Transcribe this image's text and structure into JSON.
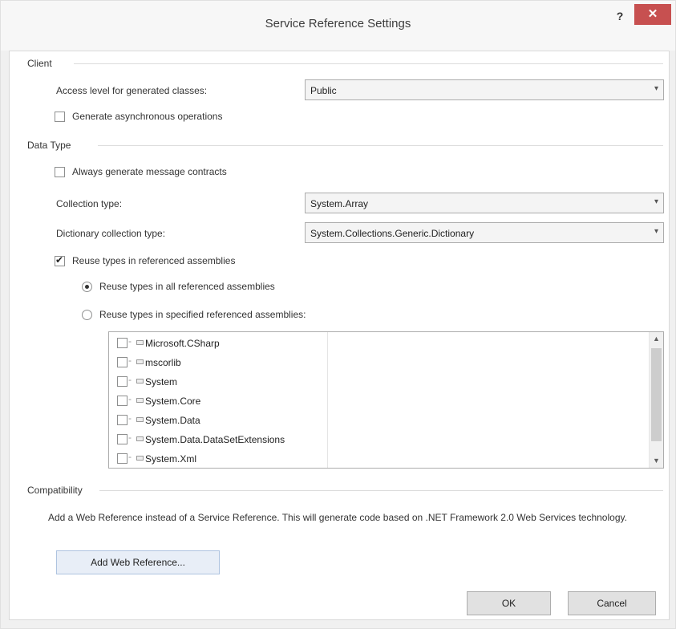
{
  "window": {
    "title": "Service Reference Settings",
    "help_label": "?",
    "close_label": "✕"
  },
  "client": {
    "group_label": "Client",
    "access_level_label": "Access level for generated classes:",
    "access_level_value": "Public",
    "async_ops_label": "Generate asynchronous operations",
    "async_ops_checked": false
  },
  "data_type": {
    "group_label": "Data Type",
    "always_contracts_label": "Always generate message contracts",
    "always_contracts_checked": false,
    "collection_label": "Collection type:",
    "collection_value": "System.Array",
    "dictionary_label": "Dictionary collection type:",
    "dictionary_value": "System.Collections.Generic.Dictionary",
    "reuse_label": "Reuse types in referenced assemblies",
    "reuse_checked": true,
    "reuse_all_label": "Reuse types in all referenced assemblies",
    "reuse_specified_label": "Reuse types in specified referenced assemblies:",
    "selected_reuse_option": "all",
    "assemblies": [
      {
        "name": "Microsoft.CSharp",
        "checked": false
      },
      {
        "name": "mscorlib",
        "checked": false
      },
      {
        "name": "System",
        "checked": false
      },
      {
        "name": "System.Core",
        "checked": false
      },
      {
        "name": "System.Data",
        "checked": false
      },
      {
        "name": "System.Data.DataSetExtensions",
        "checked": false
      },
      {
        "name": "System.Xml",
        "checked": false
      }
    ]
  },
  "compatibility": {
    "group_label": "Compatibility",
    "description": "Add a Web Reference instead of a Service Reference. This will generate code based on .NET Framework 2.0 Web Services technology.",
    "add_web_reference_label": "Add Web Reference..."
  },
  "footer": {
    "ok_label": "OK",
    "cancel_label": "Cancel"
  },
  "icons": {
    "dropdown": "chevron-down-icon",
    "check": "checkmark-icon",
    "assembly": "assembly-icon"
  }
}
